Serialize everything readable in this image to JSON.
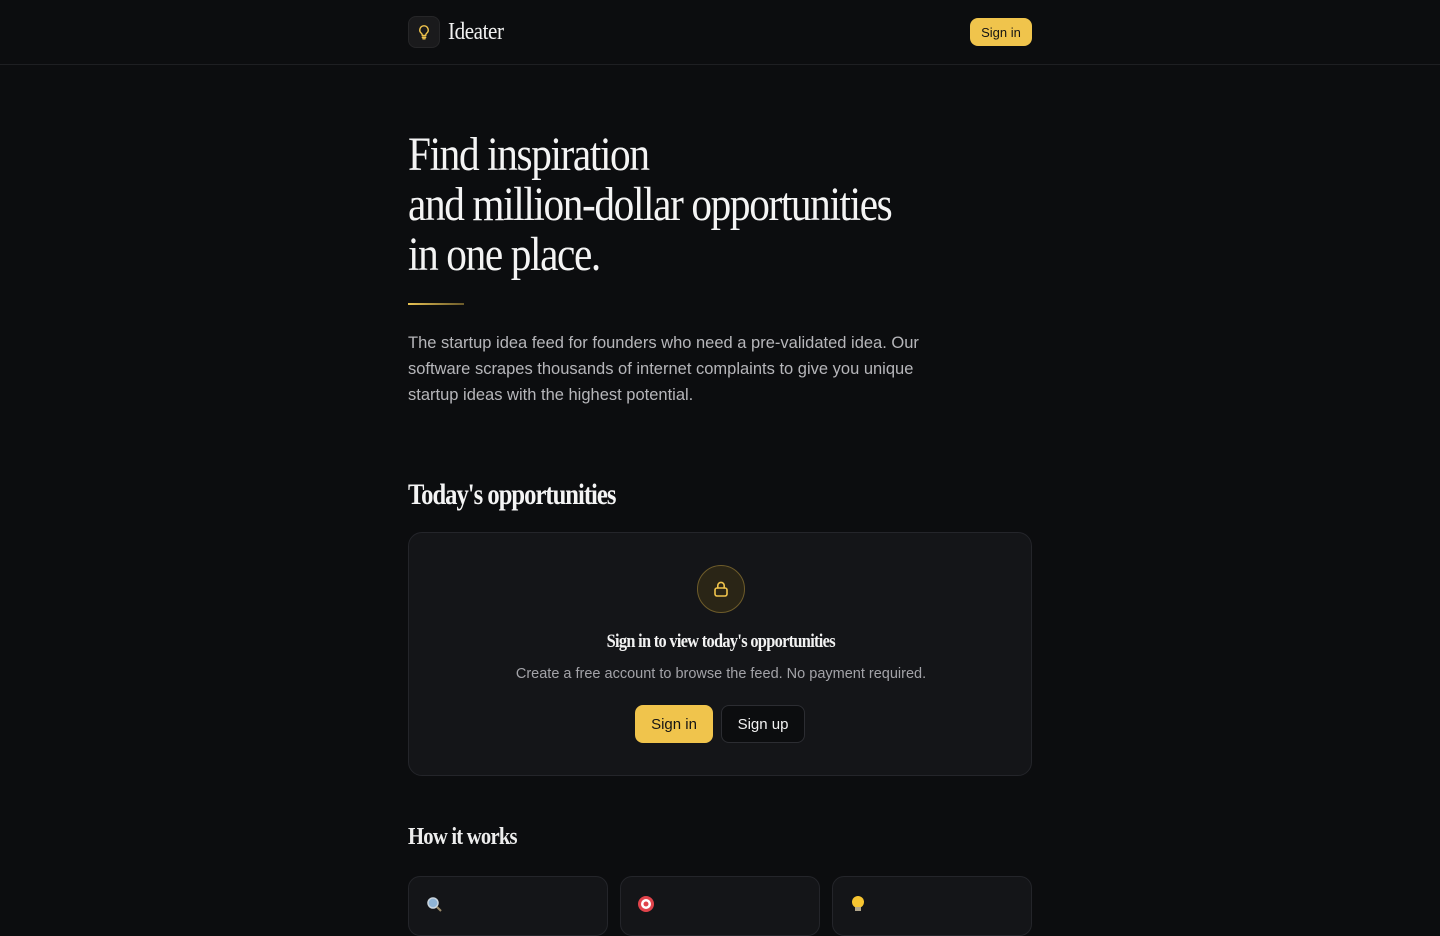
{
  "header": {
    "brand_name": "Ideater",
    "logo_icon": "lightbulb-icon",
    "signin_label": "Sign in"
  },
  "hero": {
    "title_lines": [
      "Find inspiration",
      "and million-dollar opportunities",
      "in one place."
    ],
    "description": "The startup idea feed for founders who need a pre-validated idea. Our software scrapes thousands of internet complaints to give you unique startup ideas with the highest potential."
  },
  "opportunities": {
    "heading": "Today's opportunities",
    "lock_icon": "lock-icon",
    "lock_title": "Sign in to view today's opportunities",
    "lock_subtitle": "Create a free account to browse the feed. No payment required.",
    "signin_label": "Sign in",
    "signup_label": "Sign up"
  },
  "how_it_works": {
    "heading": "How it works",
    "steps": [
      {
        "icon": "magnifier-icon"
      },
      {
        "icon": "target-icon"
      },
      {
        "icon": "lightbulb-icon"
      }
    ]
  },
  "colors": {
    "accent": "#f0c44c",
    "background": "#0c0d0f",
    "card": "#141518"
  }
}
